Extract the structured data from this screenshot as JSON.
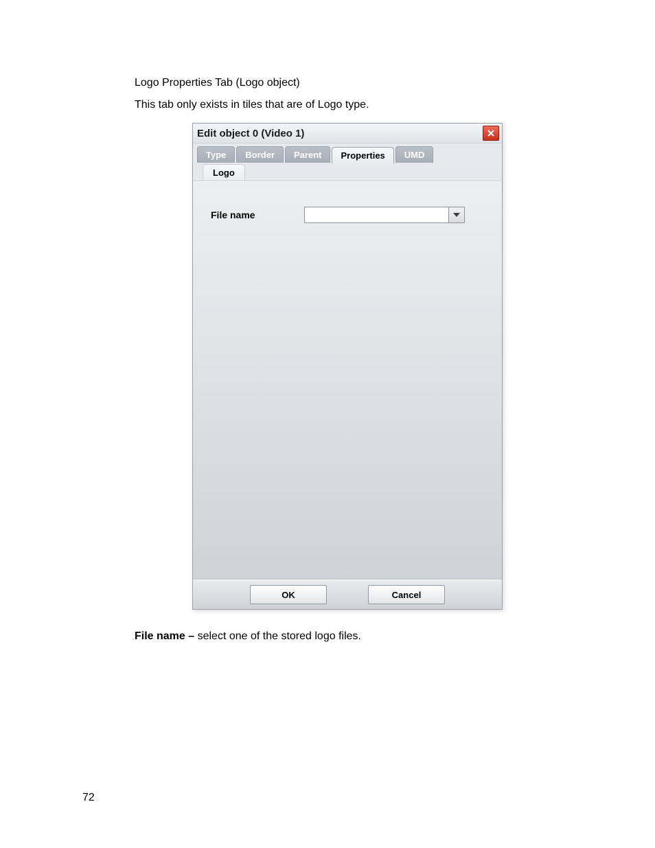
{
  "intro": {
    "line1": "Logo Properties Tab (Logo object)",
    "line2": "This tab only exists in tiles that are of Logo type."
  },
  "dialog": {
    "title": "Edit object 0 (Video 1)",
    "tabs_row1": {
      "type": "Type",
      "border": "Border",
      "parent": "Parent",
      "properties": "Properties",
      "umd": "UMD"
    },
    "tabs_row2": {
      "logo": "Logo"
    },
    "field": {
      "label": "File name",
      "value": ""
    },
    "buttons": {
      "ok": "OK",
      "cancel": "Cancel"
    }
  },
  "caption": {
    "strong": "File name – ",
    "rest": "select one of the stored logo files."
  },
  "page_number": "72"
}
